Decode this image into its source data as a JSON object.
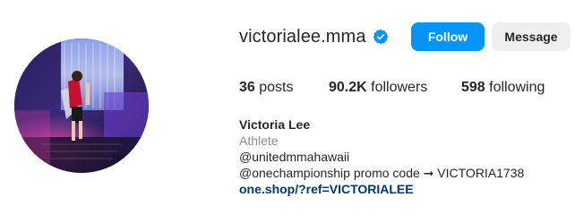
{
  "profile": {
    "username": "victorialee.mma",
    "verified_icon": "verified-badge-icon",
    "avatar_icon": "profile-photo"
  },
  "actions": {
    "follow_label": "Follow",
    "message_label": "Message"
  },
  "stats": {
    "posts_count": "36",
    "posts_label": " posts",
    "followers_count": "90.2K",
    "followers_label": " followers",
    "following_count": "598",
    "following_label": " following"
  },
  "bio": {
    "display_name": "Victoria Lee",
    "category": "Athlete",
    "line1": "@unitedmmahawaii",
    "line2": "@onechampionship promo code ➞ VICTORIA1738",
    "link": "one.shop/?ref=VICTORIALEE"
  },
  "colors": {
    "accent": "#0095f6",
    "secondary_button": "#efefef",
    "muted_text": "#8e8e8e",
    "link_text": "#00376b"
  }
}
